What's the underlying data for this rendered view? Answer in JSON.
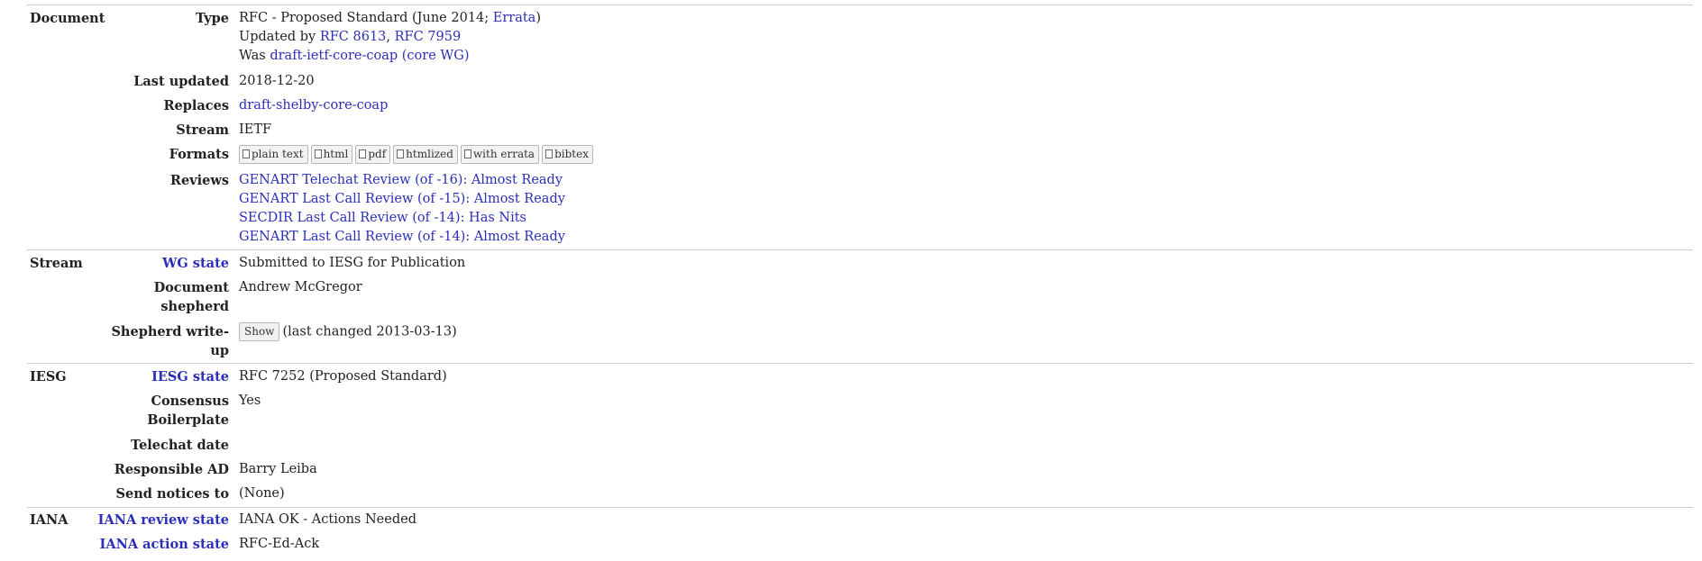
{
  "sections": {
    "document": "Document",
    "stream": "Stream",
    "iesg": "IESG",
    "iana": "IANA"
  },
  "labels": {
    "type": "Type",
    "last_updated": "Last updated",
    "replaces": "Replaces",
    "stream": "Stream",
    "formats": "Formats",
    "reviews": "Reviews",
    "wg_state": "WG state",
    "doc_shepherd": "Document shepherd",
    "shepherd_writeup": "Shepherd write-up",
    "iesg_state": "IESG state",
    "consensus": "Consensus Boilerplate",
    "telechat": "Telechat date",
    "responsible_ad": "Responsible AD",
    "send_notices": "Send notices to",
    "iana_review": "IANA review state",
    "iana_action": "IANA action state"
  },
  "type": {
    "prefix": "RFC - Proposed Standard (June 2014; ",
    "errata": "Errata",
    "suffix": ")",
    "updated_by": "Updated by ",
    "rfc8613": "RFC 8613",
    "comma": ", ",
    "rfc7959": "RFC 7959",
    "was": "Was ",
    "draft": "draft-ietf-core-coap",
    "paren_open": " (",
    "wg": "core WG",
    "paren_close": ")"
  },
  "last_updated": "2018-12-20",
  "replaces": "draft-shelby-core-coap",
  "stream": "IETF",
  "formats": [
    "plain text",
    "html",
    "pdf",
    "htmlized",
    "with errata",
    "bibtex"
  ],
  "reviews": [
    "GENART Telechat Review (of -16): Almost Ready",
    "GENART Last Call Review (of -15): Almost Ready",
    "SECDIR Last Call Review (of -14): Has Nits",
    "GENART Last Call Review (of -14): Almost Ready"
  ],
  "wg_state": "Submitted to IESG for Publication",
  "doc_shepherd": "Andrew McGregor",
  "shepherd": {
    "button": "Show",
    "changed": "(last changed 2013-03-13)"
  },
  "iesg_state": "RFC 7252 (Proposed Standard)",
  "consensus": "Yes",
  "telechat": "",
  "responsible_ad": "Barry Leiba",
  "send_notices": "(None)",
  "iana_review": "IANA OK - Actions Needed",
  "iana_action": "RFC-Ed-Ack"
}
